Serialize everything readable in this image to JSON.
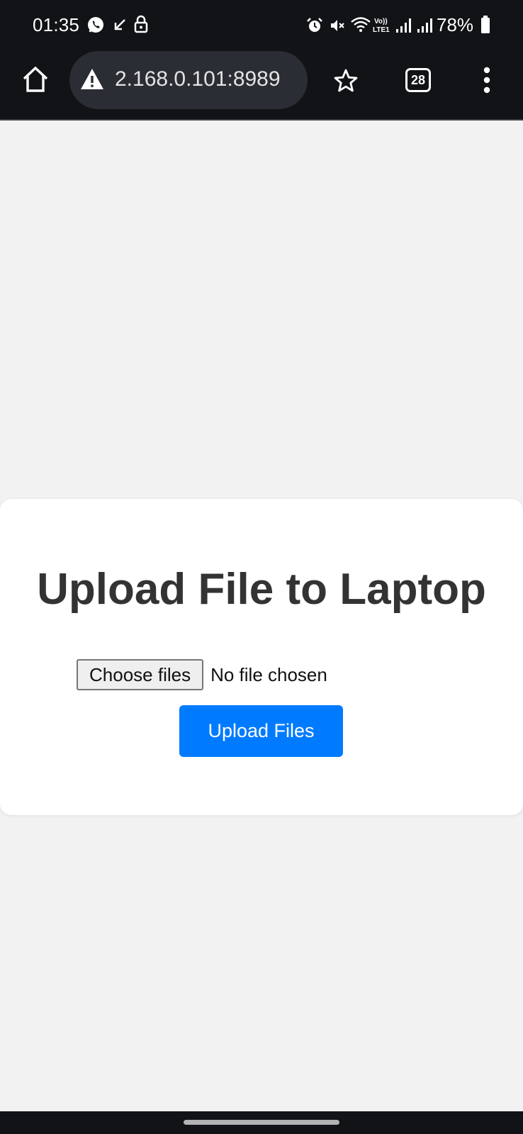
{
  "status_bar": {
    "time": "01:35",
    "network_label": "Vo)) LTE1",
    "battery": "78%",
    "left_icons": [
      "whatsapp-icon",
      "missed-call-icon",
      "lock-icon"
    ],
    "right_icons": [
      "alarm-icon",
      "mute-icon",
      "wifi-icon",
      "volte-icon",
      "signal-icon",
      "signal-icon",
      "battery-icon"
    ]
  },
  "browser": {
    "url": "2.168.0.101:8989",
    "security_icon": "warning-icon",
    "tab_count": "28"
  },
  "page": {
    "title": "Upload File to Laptop",
    "choose_files_label": "Choose files",
    "file_status": "No file chosen",
    "upload_button_label": "Upload Files",
    "accent_color": "#007bff"
  }
}
